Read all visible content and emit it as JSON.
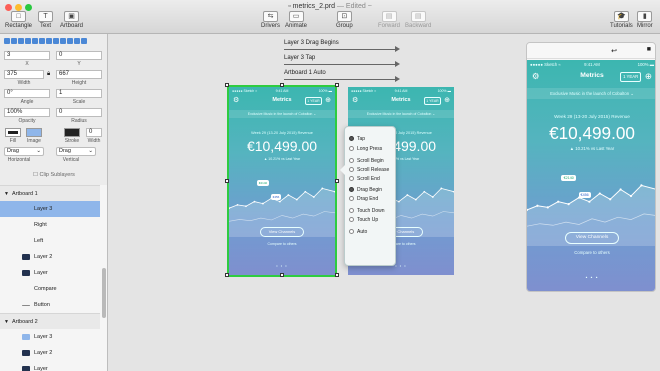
{
  "window": {
    "title": "metrics_2.prd",
    "edited": "— Edited ~"
  },
  "toolbar": {
    "left": [
      {
        "label": "Rectangle",
        "icon": "□"
      },
      {
        "label": "Text",
        "icon": "T"
      },
      {
        "label": "Artboard",
        "icon": "▣"
      }
    ],
    "center": [
      {
        "label": "Drivers",
        "icon": "⇆"
      },
      {
        "label": "Animate",
        "icon": "▭"
      },
      {
        "label": "Group",
        "icon": "⊡"
      },
      {
        "label": "Forward",
        "icon": "▤"
      },
      {
        "label": "Backward",
        "icon": "▤"
      }
    ],
    "right": [
      {
        "label": "Tutorials",
        "icon": "🎓"
      },
      {
        "label": "Mirror",
        "icon": "▮"
      }
    ]
  },
  "inspector": {
    "x": "3",
    "y": "0",
    "x_label": "X",
    "y_label": "Y",
    "width": "375",
    "height": "667",
    "width_label": "Width",
    "height_label": "Height",
    "angle": "0°",
    "scale": "1",
    "angle_label": "Angle",
    "scale_label": "Scale",
    "opacity": "100%",
    "radius": "0",
    "opacity_label": "Opacity",
    "radius_label": "Radius",
    "fill_label": "Fill",
    "image_label": "Image",
    "stroke_label": "Stroke",
    "stroke_width": "0",
    "swidth_label": "Width",
    "h_select": "Drag",
    "v_select": "Drag",
    "h_label": "Horizontal",
    "v_label": "Vertical",
    "clip_label": "Clip Sublayers"
  },
  "layers": [
    {
      "name": "Artboard 1",
      "type": "group",
      "indent": 0
    },
    {
      "name": "Layer 3",
      "type": "image",
      "indent": 2,
      "selected": true
    },
    {
      "name": "Right",
      "type": "none",
      "indent": 2
    },
    {
      "name": "Left",
      "type": "none",
      "indent": 2
    },
    {
      "name": "Layer 2",
      "type": "dark",
      "indent": 2
    },
    {
      "name": "Layer",
      "type": "dark",
      "indent": 2
    },
    {
      "name": "Compare",
      "type": "none",
      "indent": 2
    },
    {
      "name": "Button",
      "type": "line",
      "indent": 2
    },
    {
      "name": "Artboard 2",
      "type": "group",
      "indent": 0
    },
    {
      "name": "Layer 3",
      "type": "image",
      "indent": 2
    },
    {
      "name": "Layer 2",
      "type": "dark",
      "indent": 2
    },
    {
      "name": "Layer",
      "type": "dark",
      "indent": 2
    }
  ],
  "canvas": {
    "arrows": [
      "Layer 3 Drag Begins",
      "Layer 3 Tap",
      "Artboard 1 Auto"
    ],
    "phone": {
      "status_left": "●●●●● Sketch ≈",
      "status_time": "9:41 AM",
      "status_right": "100% ▬",
      "title": "Metrics",
      "toggle": "1 YEAR",
      "subtitle": "Exclusive Music in the launch of Cobalton ⌄",
      "week": "Week 29 (13-20 July 2015) Revenue",
      "amount": "€10,499.00",
      "change": "▲ 10.21% vs Last Year",
      "chart_tag_a": "€2140",
      "chart_tag_b": "€456",
      "view_button": "View Channels",
      "compare": "Compare to others"
    },
    "popup": {
      "options": [
        {
          "label": "Tap",
          "on": true
        },
        {
          "label": "Long Press",
          "on": false
        },
        {
          "label": "Scroll Begin",
          "on": false
        },
        {
          "label": "Scroll Release",
          "on": false
        },
        {
          "label": "Scroll End",
          "on": false
        },
        {
          "label": "Drag Begin",
          "on": true
        },
        {
          "label": "Drag End",
          "on": false
        },
        {
          "label": "Touch Down",
          "on": false
        },
        {
          "label": "Touch Up",
          "on": false
        },
        {
          "label": "Auto",
          "on": false
        }
      ]
    }
  },
  "mirror": {
    "status_left": "●●●●● Sketch ≈",
    "status_time": "9:41 AM",
    "status_right": "100% ▬",
    "title": "Metrics",
    "toggle": "1 YEAR",
    "subtitle": "Exclusive Music in the launch of Cobalton ⌄",
    "week": "Week 29 (13-20 July 2015) Revenue",
    "amount": "€10,499.00",
    "change": "▲ 10.21% vs Last Year",
    "chart_tag_a": "€2140",
    "chart_tag_b": "€456",
    "view_button": "View Channels",
    "compare": "Compare to others",
    "back_icon": "↩",
    "camera_icon": "■"
  },
  "colors": {
    "accent": "#4b88d6",
    "selection": "#2ecc40",
    "phone_top": "#3cb6b0",
    "phone_bottom": "#7f8fcf",
    "layer_selected": "#8fb6ea"
  }
}
